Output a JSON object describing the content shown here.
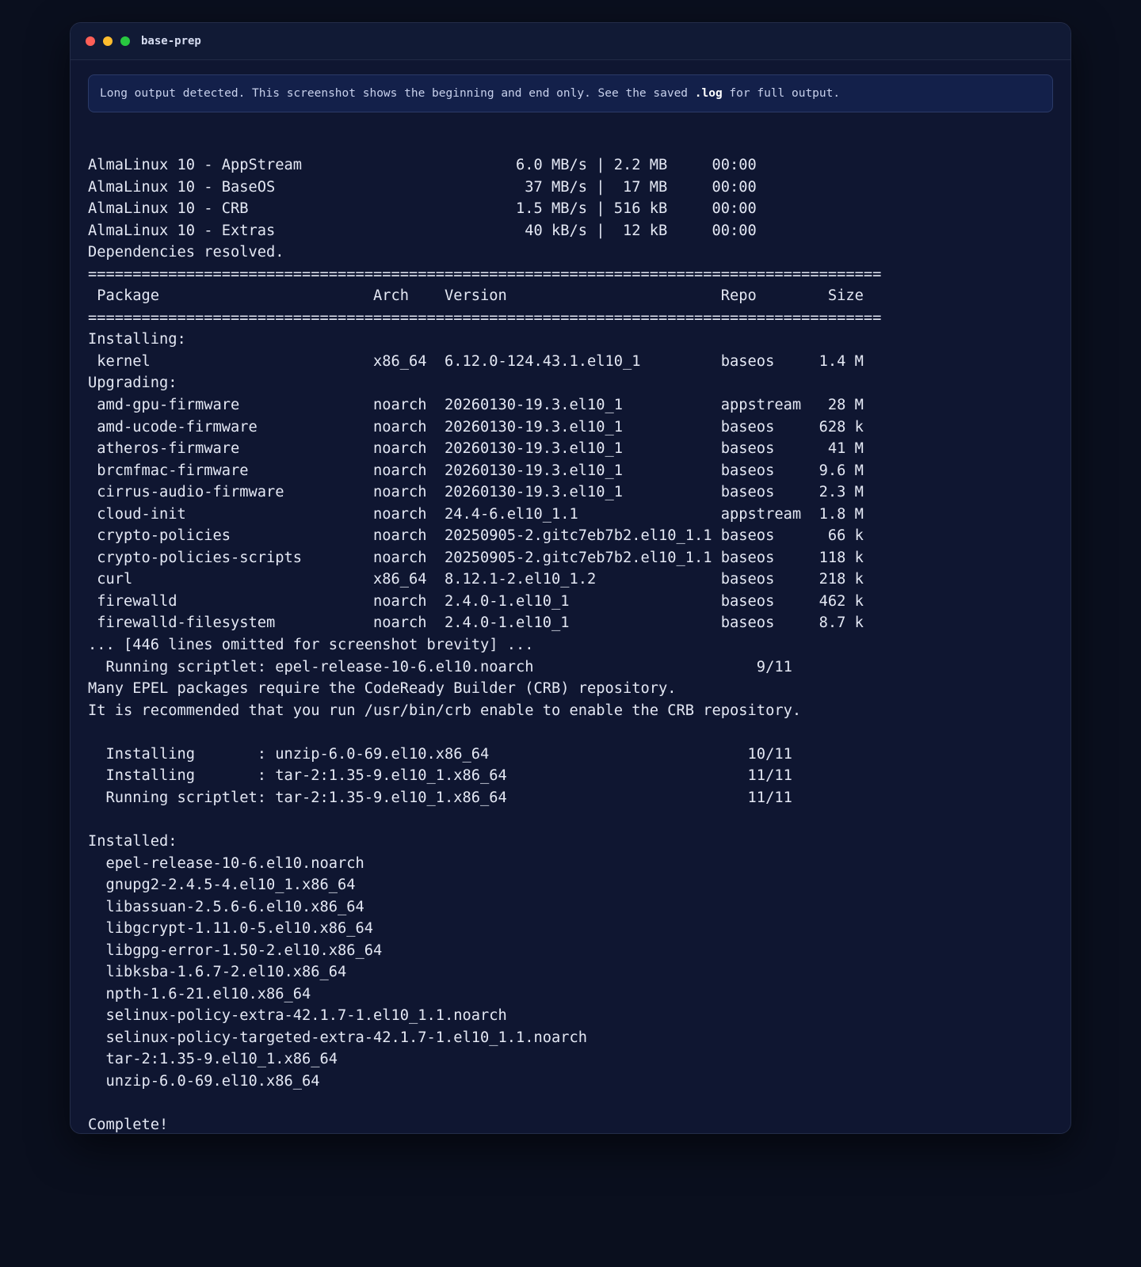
{
  "window": {
    "title": "base-prep"
  },
  "notice": {
    "prefix": "Long output detected. This screenshot shows the beginning and end only. See the saved ",
    "highlight": ".log",
    "suffix": " for full output."
  },
  "colors": {
    "background": "#0a0f1e",
    "window_bg": "#0f1631",
    "text": "#e4e8f4",
    "notice_bg": "#13204a",
    "close": "#ff5f57",
    "minimize": "#febc2e",
    "maximize": "#28c840"
  },
  "output_lines": [
    "AlmaLinux 10 - AppStream                        6.0 MB/s | 2.2 MB     00:00",
    "AlmaLinux 10 - BaseOS                            37 MB/s |  17 MB     00:00",
    "AlmaLinux 10 - CRB                              1.5 MB/s | 516 kB     00:00",
    "AlmaLinux 10 - Extras                            40 kB/s |  12 kB     00:00",
    "Dependencies resolved.",
    "=========================================================================================",
    " Package                        Arch    Version                        Repo        Size",
    "=========================================================================================",
    "Installing:",
    " kernel                         x86_64  6.12.0-124.43.1.el10_1         baseos     1.4 M",
    "Upgrading:",
    " amd-gpu-firmware               noarch  20260130-19.3.el10_1           appstream   28 M",
    " amd-ucode-firmware             noarch  20260130-19.3.el10_1           baseos     628 k",
    " atheros-firmware               noarch  20260130-19.3.el10_1           baseos      41 M",
    " brcmfmac-firmware              noarch  20260130-19.3.el10_1           baseos     9.6 M",
    " cirrus-audio-firmware          noarch  20260130-19.3.el10_1           baseos     2.3 M",
    " cloud-init                     noarch  24.4-6.el10_1.1                appstream  1.8 M",
    " crypto-policies                noarch  20250905-2.gitc7eb7b2.el10_1.1 baseos      66 k",
    " crypto-policies-scripts        noarch  20250905-2.gitc7eb7b2.el10_1.1 baseos     118 k",
    " curl                           x86_64  8.12.1-2.el10_1.2              baseos     218 k",
    " firewalld                      noarch  2.4.0-1.el10_1                 baseos     462 k",
    " firewalld-filesystem           noarch  2.4.0-1.el10_1                 baseos     8.7 k",
    "... [446 lines omitted for screenshot brevity] ...",
    "  Running scriptlet: epel-release-10-6.el10.noarch                         9/11",
    "Many EPEL packages require the CodeReady Builder (CRB) repository.",
    "It is recommended that you run /usr/bin/crb enable to enable the CRB repository.",
    "",
    "  Installing       : unzip-6.0-69.el10.x86_64                             10/11",
    "  Installing       : tar-2:1.35-9.el10_1.x86_64                           11/11",
    "  Running scriptlet: tar-2:1.35-9.el10_1.x86_64                           11/11",
    "",
    "Installed:",
    "  epel-release-10-6.el10.noarch",
    "  gnupg2-2.4.5-4.el10_1.x86_64",
    "  libassuan-2.5.6-6.el10.x86_64",
    "  libgcrypt-1.11.0-5.el10.x86_64",
    "  libgpg-error-1.50-2.el10.x86_64",
    "  libksba-1.6.7-2.el10.x86_64",
    "  npth-1.6-21.el10.x86_64",
    "  selinux-policy-extra-42.1.7-1.el10_1.1.noarch",
    "  selinux-policy-targeted-extra-42.1.7-1.el10_1.1.noarch",
    "  tar-2:1.35-9.el10_1.x86_64",
    "  unzip-6.0-69.el10.x86_64",
    "",
    "Complete!"
  ]
}
